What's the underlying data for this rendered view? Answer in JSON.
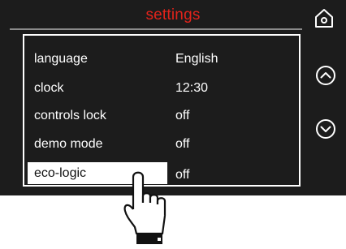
{
  "screen": {
    "title": "settings",
    "accent_color": "#e3231b",
    "background_color": "#1c1c1c"
  },
  "settings": {
    "rows": [
      {
        "label": "language",
        "value": "English"
      },
      {
        "label": "clock",
        "value": "12:30"
      },
      {
        "label": "controls lock",
        "value": "off"
      },
      {
        "label": "demo mode",
        "value": "off"
      },
      {
        "label": "eco-logic",
        "value": "off",
        "selected": true
      }
    ]
  },
  "buttons": {
    "home_icon": "home-icon",
    "up_icon": "chevron-up-circle-icon",
    "down_icon": "chevron-down-circle-icon"
  },
  "illustration": {
    "pointer_icon": "pointing-hand-icon"
  }
}
